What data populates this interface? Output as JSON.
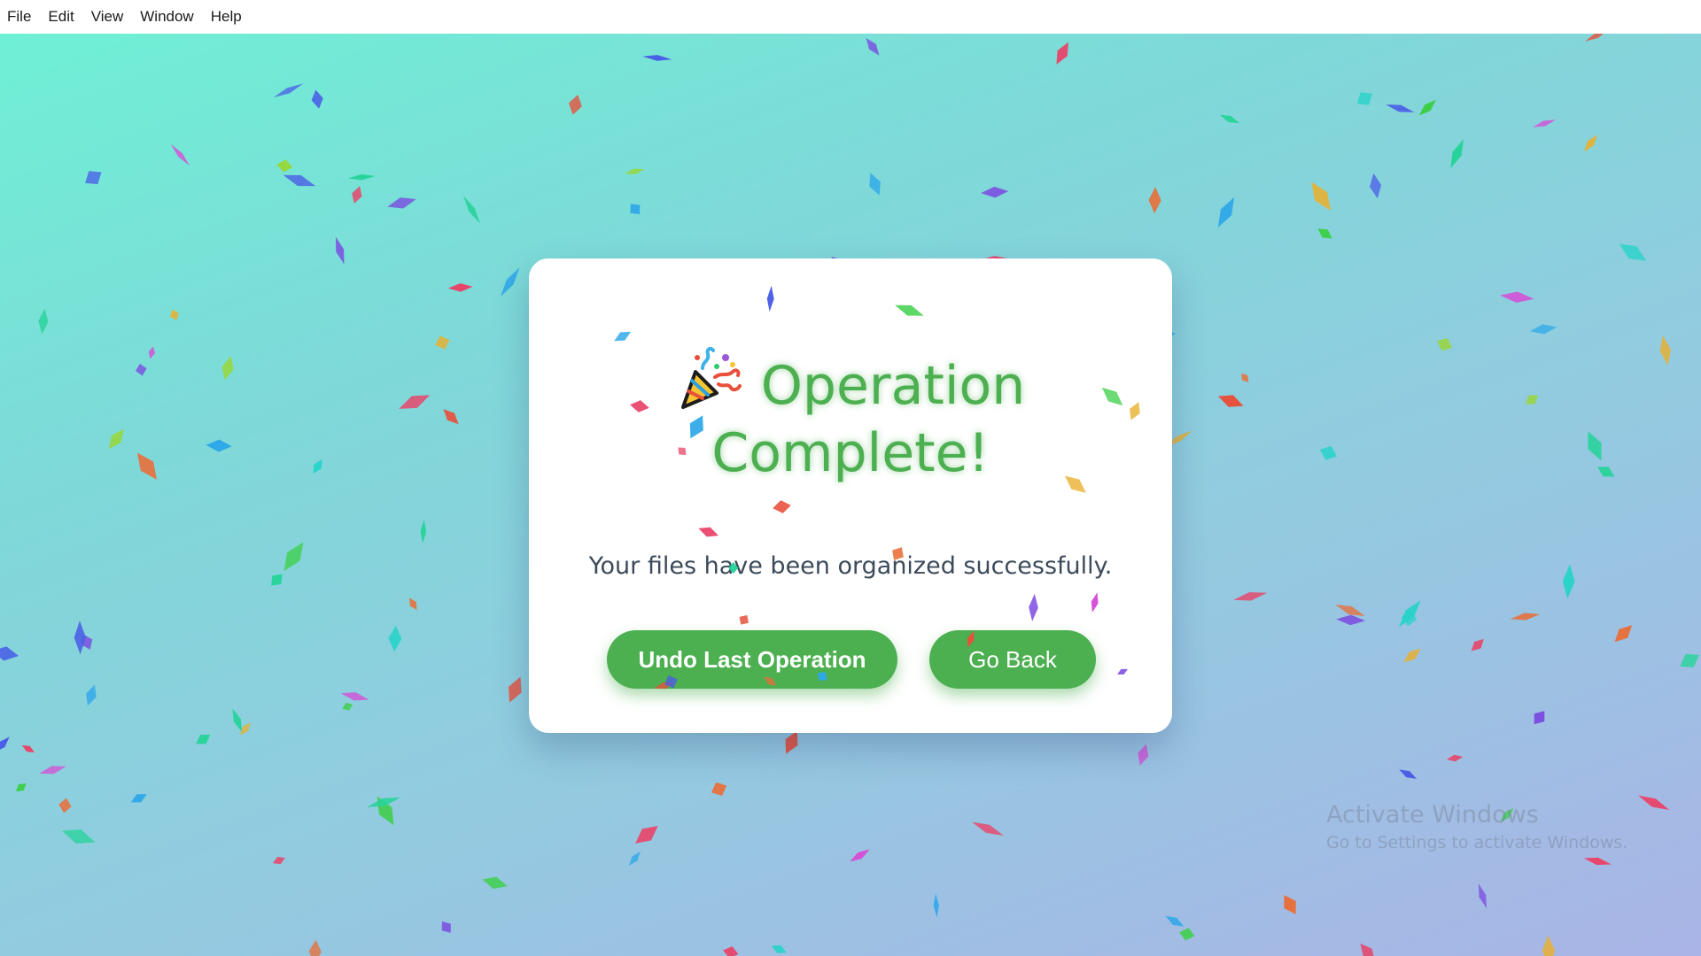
{
  "menu": {
    "items": [
      "File",
      "Edit",
      "View",
      "Window",
      "Help"
    ]
  },
  "dialog": {
    "icon": "party-popper-icon",
    "title_line1": "Operation",
    "title_line2": "Complete!",
    "subtitle": "Your files have been organized successfully.",
    "undo_label": "Undo Last Operation",
    "back_label": "Go Back"
  },
  "watermark": {
    "title": "Activate Windows",
    "subtitle": "Go to Settings to activate Windows."
  },
  "colors": {
    "accent_green": "#4caf50",
    "background_start": "#6ff0d6",
    "background_end": "#aab4e6",
    "card": "#ffffff",
    "subtitle_text": "#3c4a5a"
  }
}
